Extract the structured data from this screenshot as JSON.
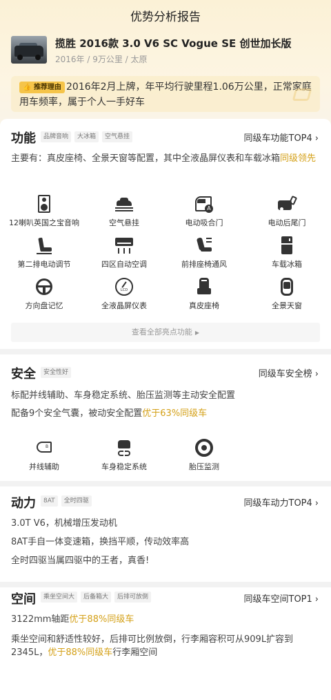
{
  "header": {
    "title": "优势分析报告"
  },
  "car": {
    "name": "揽胜 2016款 3.0 V6 SC Vogue SE 创世加长版",
    "meta": "2016年 / 9万公里 / 太原"
  },
  "recommend": {
    "tag": "推荐理由",
    "text": "2016年2月上牌，年平均行驶里程1.06万公里，正常家庭用车频率，属于个人一手好车"
  },
  "function": {
    "title": "功能",
    "tags": [
      "品牌音响",
      "大冰箱",
      "空气悬挂"
    ],
    "rank": "同级车功能TOP4",
    "desc_main": "主要有：真皮座椅、全景天窗等配置，其中全液晶屏仪表和车载冰箱",
    "desc_hl": "同级领先",
    "features": [
      {
        "label": "12喇叭英国之宝音响",
        "icon": "speaker-icon"
      },
      {
        "label": "空气悬挂",
        "icon": "air-suspension-icon"
      },
      {
        "label": "电动吸合门",
        "icon": "car-door-icon"
      },
      {
        "label": "电动后尾门",
        "icon": "tailgate-icon"
      },
      {
        "label": "第二排电动调节",
        "icon": "seat-adjust-icon"
      },
      {
        "label": "四区自动空调",
        "icon": "air-conditioner-icon"
      },
      {
        "label": "前排座椅通风",
        "icon": "seat-ventilation-icon"
      },
      {
        "label": "车载冰箱",
        "icon": "fridge-icon"
      },
      {
        "label": "方向盘记忆",
        "icon": "steering-wheel-icon"
      },
      {
        "label": "全液晶屏仪表",
        "icon": "lcd-gauge-icon"
      },
      {
        "label": "真皮座椅",
        "icon": "leather-seat-icon"
      },
      {
        "label": "全景天窗",
        "icon": "sunroof-icon"
      }
    ],
    "view_all": "查看全部亮点功能"
  },
  "safety": {
    "title": "安全",
    "tags": [
      "安全性好"
    ],
    "rank": "同级车安全榜",
    "line1": "标配并线辅助、车身稳定系统、胎压监测等主动安全配置",
    "line2_main": "配备9个安全气囊，被动安全配置",
    "line2_hl": "优于63%同级车",
    "features": [
      {
        "label": "并线辅助",
        "icon": "blind-spot-icon"
      },
      {
        "label": "车身稳定系统",
        "icon": "stability-control-icon"
      },
      {
        "label": "胎压监测",
        "icon": "tire-pressure-icon"
      }
    ]
  },
  "power": {
    "title": "动力",
    "tags": [
      "8AT",
      "全时四驱"
    ],
    "rank": "同级车动力TOP4",
    "lines": [
      "3.0T V6，机械增压发动机",
      "8AT手自一体变速箱，换挡平顺，传动效率高",
      "全时四驱当属四驱中的王者，真香!"
    ]
  },
  "space": {
    "title": "空间",
    "tags": [
      "乘坐空间大",
      "后备箱大",
      "后排可放倒"
    ],
    "rank": "同级车空间TOP1",
    "line1_main": "3122mm轴距",
    "line1_hl": "优于88%同级车",
    "line2_main": "乘坐空间和舒适性较好，后排可比例放倒，行李厢容积可从909L扩容到",
    "line3_main": "2345L，",
    "line3_hl": "优于88%同级车",
    "line3_tail": "行李厢空间"
  },
  "colors": {
    "accent": "#d4a017",
    "tag_bg": "#f5c44a",
    "icon": "#333333"
  }
}
